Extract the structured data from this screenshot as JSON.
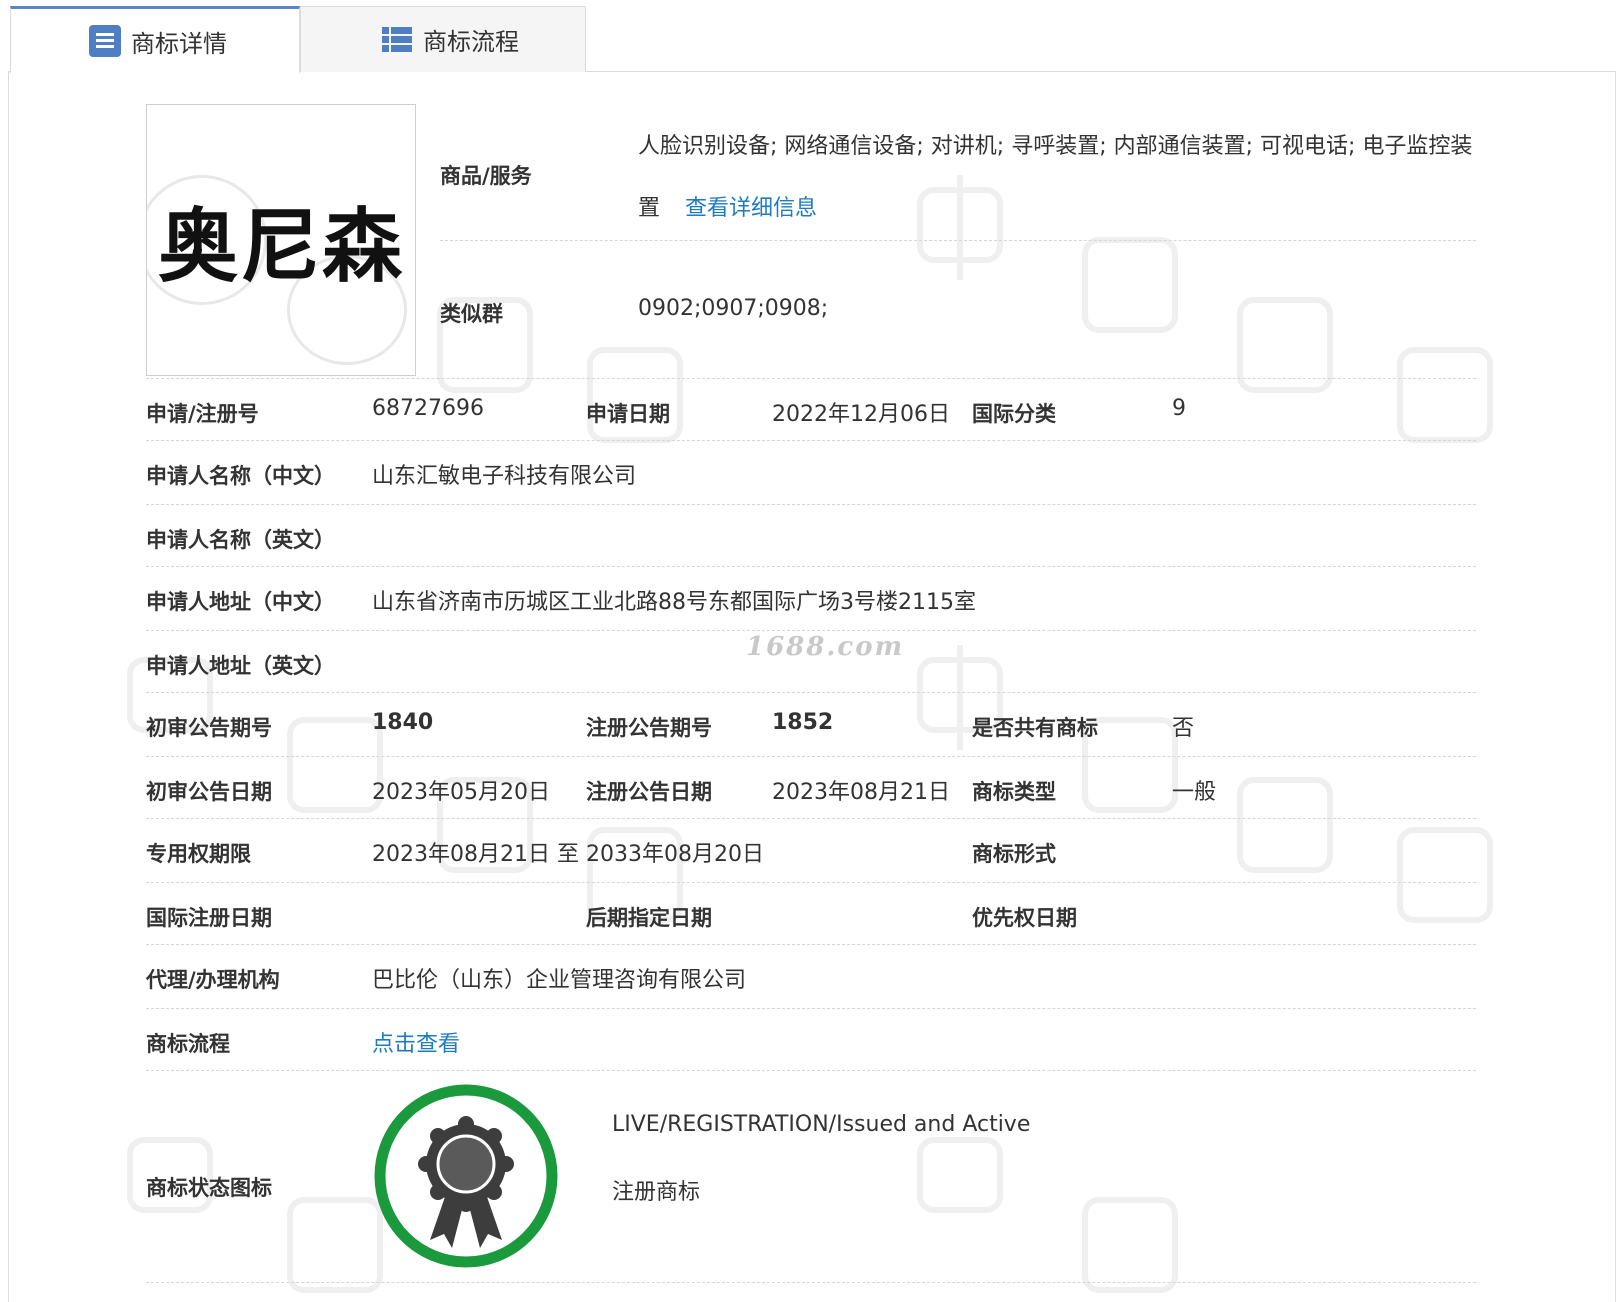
{
  "tabs": [
    {
      "label": "商标详情",
      "icon": "list-doc-icon",
      "active": true
    },
    {
      "label": "商标流程",
      "icon": "list-grid-icon",
      "active": false
    }
  ],
  "logo": {
    "text": "奥尼森"
  },
  "goods": {
    "label": "商品/服务",
    "line1": "人脸识别设备; 网络通信设备; 对讲机; 寻呼装置; 内部通信装置; 可视电话; 电子监控装",
    "line2": "置",
    "link": "查看详细信息"
  },
  "similar": {
    "label": "类似群",
    "value": "0902;0907;0908;"
  },
  "rows": {
    "reg_no": {
      "label": "申请/注册号",
      "value": "68727696"
    },
    "apply_date": {
      "label": "申请日期",
      "value": "2022年12月06日"
    },
    "intl_class": {
      "label": "国际分类",
      "value": "9"
    },
    "applicant_cn": {
      "label": "申请人名称（中文）",
      "value": "山东汇敏电子科技有限公司"
    },
    "applicant_en": {
      "label": "申请人名称（英文）",
      "value": ""
    },
    "address_cn": {
      "label": "申请人地址（中文）",
      "value": "山东省济南市历城区工业北路88号东都国际广场3号楼2115室"
    },
    "address_en": {
      "label": "申请人地址（英文）",
      "value": ""
    },
    "prelim_no": {
      "label": "初审公告期号",
      "value": "1840"
    },
    "reg_notice_no": {
      "label": "注册公告期号",
      "value": "1852"
    },
    "shared": {
      "label": "是否共有商标",
      "value": "否"
    },
    "prelim_date": {
      "label": "初审公告日期",
      "value": "2023年05月20日"
    },
    "reg_notice_date": {
      "label": "注册公告日期",
      "value": "2023年08月21日"
    },
    "tm_type": {
      "label": "商标类型",
      "value": "一般"
    },
    "exclusive_period": {
      "label": "专用权期限",
      "value": "2023年08月21日 至 2033年08月20日"
    },
    "tm_form": {
      "label": "商标形式",
      "value": ""
    },
    "intl_reg_date": {
      "label": "国际注册日期",
      "value": ""
    },
    "later_designation": {
      "label": "后期指定日期",
      "value": ""
    },
    "priority_date": {
      "label": "优先权日期",
      "value": ""
    },
    "agent": {
      "label": "代理/办理机构",
      "value": "巴比伦（山东）企业管理咨询有限公司"
    },
    "process": {
      "label": "商标流程",
      "link": "点击查看"
    },
    "status_icon": {
      "label": "商标状态图标",
      "status_en": "LIVE/REGISTRATION/Issued and Active",
      "status_cn": "注册商标",
      "icon": "award-ribbon-icon",
      "ring_color": "#1a9a3c"
    }
  },
  "watermark": {
    "site": "1688.com"
  }
}
